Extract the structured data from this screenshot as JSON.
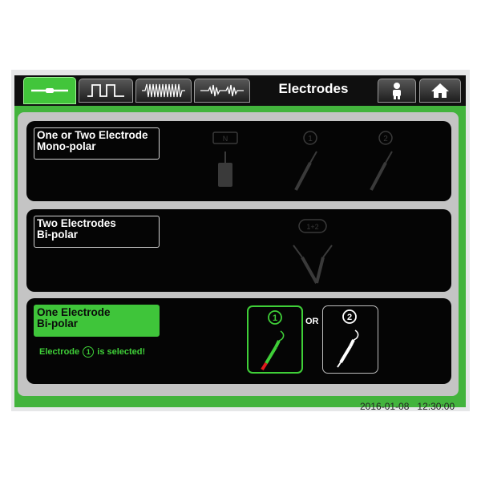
{
  "header": {
    "title": "Electrodes",
    "tabs": [
      {
        "name": "electrode-tab",
        "icon": "electrode-probe-icon",
        "active": true
      },
      {
        "name": "pulse-tab",
        "icon": "square-wave-icon",
        "active": false
      },
      {
        "name": "burst-tab",
        "icon": "dense-wave-icon",
        "active": false
      },
      {
        "name": "modulated-tab",
        "icon": "modulated-wave-icon",
        "active": false
      }
    ],
    "right_buttons": [
      {
        "name": "patient-button",
        "icon": "patient-icon"
      },
      {
        "name": "home-button",
        "icon": "home-icon"
      }
    ]
  },
  "modes": [
    {
      "label_line1": "One or Two Electrode",
      "label_line2": "Mono-polar",
      "selected": false,
      "badges": [
        "N",
        "1",
        "2"
      ]
    },
    {
      "label_line1": "Two Electrodes",
      "label_line2": "Bi-polar",
      "selected": false,
      "badges": [
        "1+2"
      ]
    },
    {
      "label_line1": "One Electrode",
      "label_line2": "Bi-polar",
      "selected": true,
      "status_prefix": "Electrode",
      "status_number": "1",
      "status_suffix": "is selected!",
      "options": [
        {
          "number": "1",
          "selected": true
        },
        {
          "number": "2",
          "selected": false
        }
      ],
      "or_label": "OR"
    }
  ],
  "footer": {
    "date": "2016-01-08",
    "time": "12:30:00"
  },
  "colors": {
    "accent": "#3fcf38",
    "panel": "#050505",
    "frame": "#43b43d",
    "content_bg": "#c4c4c4"
  }
}
